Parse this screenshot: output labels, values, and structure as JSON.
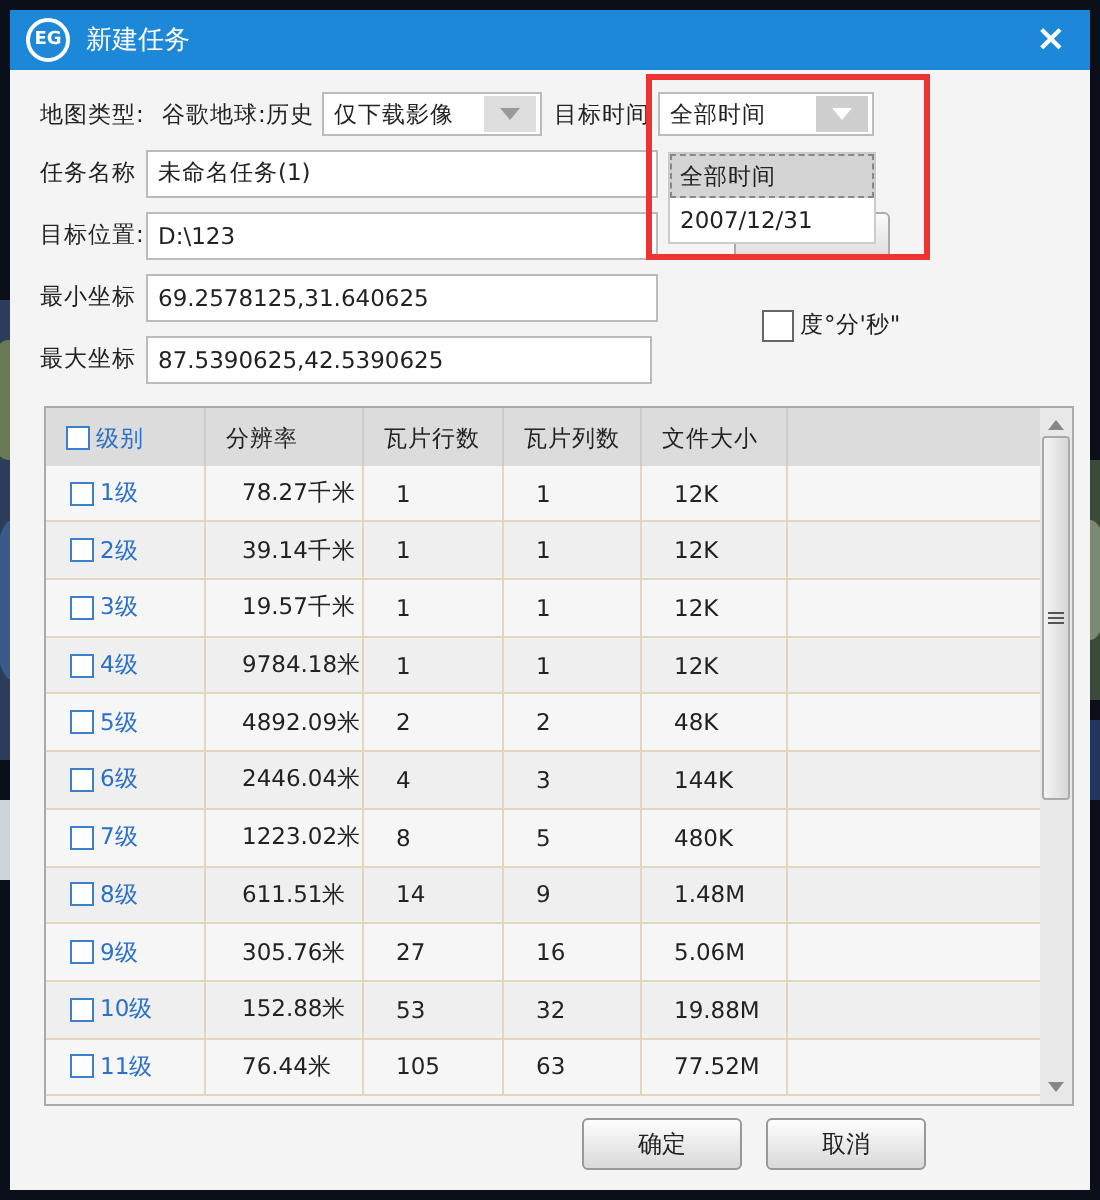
{
  "window": {
    "logo": "EG",
    "title": "新建任务",
    "close": "×"
  },
  "map_type": {
    "label": "地图类型:",
    "value": "谷歌地球:历史",
    "select": {
      "value": "仅下载影像",
      "disabled": true
    }
  },
  "target_time": {
    "label": "目标时间",
    "select": {
      "value": "全部时间",
      "expanded": true,
      "options": [
        {
          "label": "全部时间",
          "selected": true
        },
        {
          "label": "2007/12/31",
          "selected": false
        }
      ]
    }
  },
  "task_name": {
    "label": "任务名称",
    "value": "未命名任务(1)"
  },
  "target_location": {
    "label": "目标位置:",
    "value": "D:\\123"
  },
  "min_coord": {
    "label": "最小坐标",
    "value": "69.2578125,31.640625"
  },
  "max_coord": {
    "label": "最大坐标",
    "value": "87.5390625,42.5390625"
  },
  "dms_checkbox": {
    "label": "度°分'秒\"",
    "checked": false
  },
  "table": {
    "select_all": {
      "label": "级别",
      "checked": false
    },
    "columns": [
      "分辨率",
      "瓦片行数",
      "瓦片列数",
      "文件大小"
    ],
    "rows": [
      {
        "level": "1级",
        "checked": false,
        "cells": [
          "78.27千米",
          "1",
          "1",
          "12K"
        ]
      },
      {
        "level": "2级",
        "checked": false,
        "cells": [
          "39.14千米",
          "1",
          "1",
          "12K"
        ]
      },
      {
        "level": "3级",
        "checked": false,
        "cells": [
          "19.57千米",
          "1",
          "1",
          "12K"
        ]
      },
      {
        "level": "4级",
        "checked": false,
        "cells": [
          "9784.18米",
          "1",
          "1",
          "12K"
        ]
      },
      {
        "level": "5级",
        "checked": false,
        "cells": [
          "4892.09米",
          "2",
          "2",
          "48K"
        ]
      },
      {
        "level": "6级",
        "checked": false,
        "cells": [
          "2446.04米",
          "4",
          "3",
          "144K"
        ]
      },
      {
        "level": "7级",
        "checked": false,
        "cells": [
          "1223.02米",
          "8",
          "5",
          "480K"
        ]
      },
      {
        "level": "8级",
        "checked": false,
        "cells": [
          "611.51米",
          "14",
          "9",
          "1.48M"
        ]
      },
      {
        "level": "9级",
        "checked": false,
        "cells": [
          "305.76米",
          "27",
          "16",
          "5.06M"
        ]
      },
      {
        "level": "10级",
        "checked": false,
        "cells": [
          "152.88米",
          "53",
          "32",
          "19.88M"
        ]
      },
      {
        "level": "11级",
        "checked": false,
        "cells": [
          "76.44米",
          "105",
          "63",
          "77.52M"
        ]
      }
    ]
  },
  "buttons": [
    "确定",
    "取消"
  ]
}
